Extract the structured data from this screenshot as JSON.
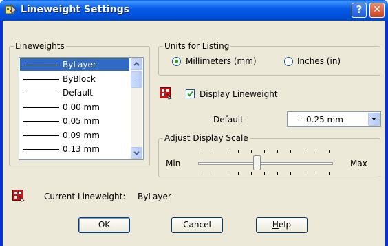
{
  "window": {
    "title": "Lineweight Settings",
    "help_glyph": "?",
    "close_glyph": "✕"
  },
  "lineweights": {
    "legend": "Lineweights",
    "items": [
      {
        "label": "ByLayer",
        "selected": true
      },
      {
        "label": "ByBlock"
      },
      {
        "label": "Default"
      },
      {
        "label": "0.00 mm"
      },
      {
        "label": "0.05 mm"
      },
      {
        "label": "0.09 mm"
      },
      {
        "label": "0.13 mm"
      }
    ]
  },
  "units": {
    "legend": "Units for Listing",
    "millimeters": {
      "underline": "M",
      "rest": "illimeters (mm)",
      "selected": true
    },
    "inches": {
      "underline": "I",
      "rest": "nches (in)",
      "selected": false
    }
  },
  "display": {
    "checkbox_underline": "D",
    "checkbox_rest": "isplay Lineweight",
    "checked": true,
    "default_label": "Default",
    "default_value": "0.25 mm"
  },
  "scale": {
    "legend": "Adjust Display Scale",
    "min_label": "Min",
    "max_label": "Max",
    "position": 0.44
  },
  "current": {
    "label": "Current Lineweight:",
    "value": "ByLayer"
  },
  "buttons": {
    "ok": "OK",
    "cancel": "Cancel",
    "help_underline": "H",
    "help_rest": "elp"
  },
  "colors": {
    "selection": "#316ac5",
    "titlebar": "#0a5ce6",
    "dialog": "#ece9d8"
  }
}
